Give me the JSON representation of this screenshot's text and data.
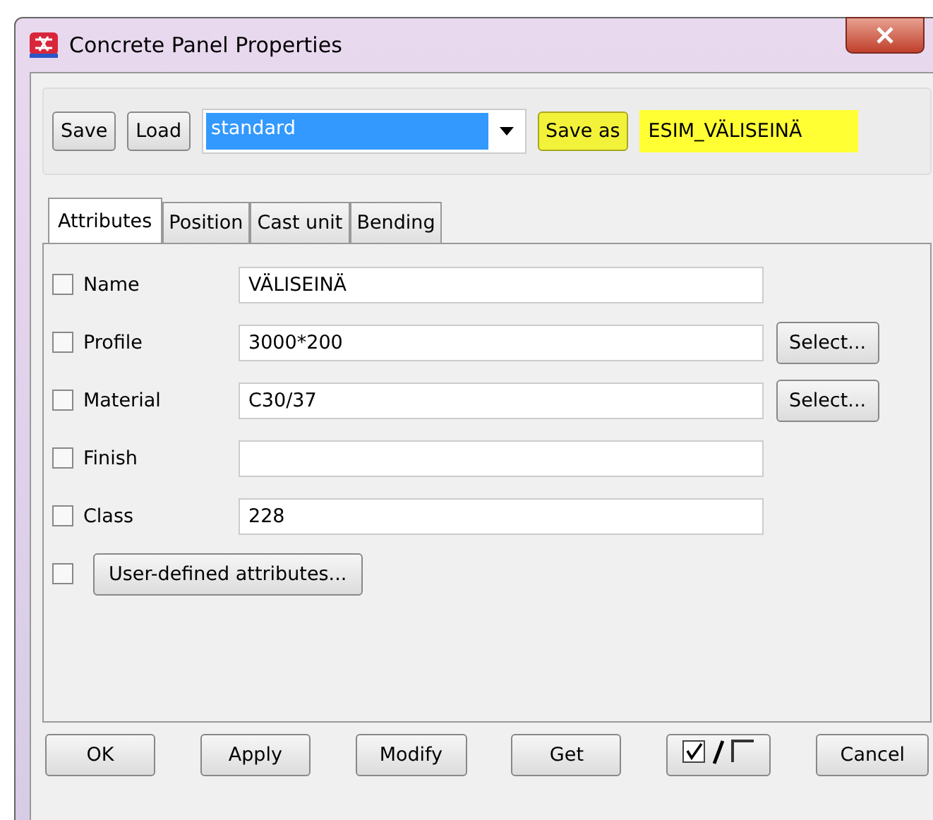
{
  "window": {
    "title": "Concrete Panel Properties"
  },
  "toolbar": {
    "save": "Save",
    "load": "Load",
    "preset": "standard",
    "save_as": "Save as",
    "save_as_name": "ESIM_VÄLISEINÄ"
  },
  "tabs": [
    {
      "label": "Attributes",
      "selected": true
    },
    {
      "label": "Position",
      "selected": false
    },
    {
      "label": "Cast unit",
      "selected": false
    },
    {
      "label": "Bending",
      "selected": false
    }
  ],
  "fields": [
    {
      "label": "Name",
      "checked": false,
      "value": "VÄLISEINÄ"
    },
    {
      "label": "Profile",
      "checked": false,
      "value": "3000*200",
      "button": "Select..."
    },
    {
      "label": "Material",
      "checked": false,
      "value": "C30/37",
      "button": "Select..."
    },
    {
      "label": "Finish",
      "checked": false
    },
    {
      "label": "Class",
      "checked": false,
      "value": "228"
    }
  ],
  "user_defined": {
    "checked": false,
    "button": "User-defined attributes..."
  },
  "buttons": [
    "OK",
    "Apply",
    "Modify",
    "Get"
  ],
  "cancel": "Cancel"
}
